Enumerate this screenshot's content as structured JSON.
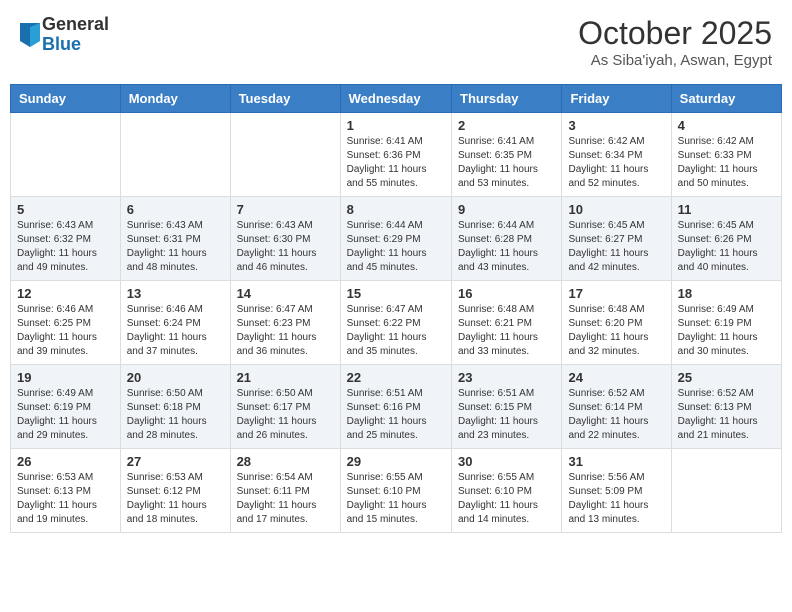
{
  "header": {
    "logo_general": "General",
    "logo_blue": "Blue",
    "month_title": "October 2025",
    "location": "As Siba'iyah, Aswan, Egypt"
  },
  "days_of_week": [
    "Sunday",
    "Monday",
    "Tuesday",
    "Wednesday",
    "Thursday",
    "Friday",
    "Saturday"
  ],
  "weeks": [
    [
      {
        "day": "",
        "info": ""
      },
      {
        "day": "",
        "info": ""
      },
      {
        "day": "",
        "info": ""
      },
      {
        "day": "1",
        "info": "Sunrise: 6:41 AM\nSunset: 6:36 PM\nDaylight: 11 hours and 55 minutes."
      },
      {
        "day": "2",
        "info": "Sunrise: 6:41 AM\nSunset: 6:35 PM\nDaylight: 11 hours and 53 minutes."
      },
      {
        "day": "3",
        "info": "Sunrise: 6:42 AM\nSunset: 6:34 PM\nDaylight: 11 hours and 52 minutes."
      },
      {
        "day": "4",
        "info": "Sunrise: 6:42 AM\nSunset: 6:33 PM\nDaylight: 11 hours and 50 minutes."
      }
    ],
    [
      {
        "day": "5",
        "info": "Sunrise: 6:43 AM\nSunset: 6:32 PM\nDaylight: 11 hours and 49 minutes."
      },
      {
        "day": "6",
        "info": "Sunrise: 6:43 AM\nSunset: 6:31 PM\nDaylight: 11 hours and 48 minutes."
      },
      {
        "day": "7",
        "info": "Sunrise: 6:43 AM\nSunset: 6:30 PM\nDaylight: 11 hours and 46 minutes."
      },
      {
        "day": "8",
        "info": "Sunrise: 6:44 AM\nSunset: 6:29 PM\nDaylight: 11 hours and 45 minutes."
      },
      {
        "day": "9",
        "info": "Sunrise: 6:44 AM\nSunset: 6:28 PM\nDaylight: 11 hours and 43 minutes."
      },
      {
        "day": "10",
        "info": "Sunrise: 6:45 AM\nSunset: 6:27 PM\nDaylight: 11 hours and 42 minutes."
      },
      {
        "day": "11",
        "info": "Sunrise: 6:45 AM\nSunset: 6:26 PM\nDaylight: 11 hours and 40 minutes."
      }
    ],
    [
      {
        "day": "12",
        "info": "Sunrise: 6:46 AM\nSunset: 6:25 PM\nDaylight: 11 hours and 39 minutes."
      },
      {
        "day": "13",
        "info": "Sunrise: 6:46 AM\nSunset: 6:24 PM\nDaylight: 11 hours and 37 minutes."
      },
      {
        "day": "14",
        "info": "Sunrise: 6:47 AM\nSunset: 6:23 PM\nDaylight: 11 hours and 36 minutes."
      },
      {
        "day": "15",
        "info": "Sunrise: 6:47 AM\nSunset: 6:22 PM\nDaylight: 11 hours and 35 minutes."
      },
      {
        "day": "16",
        "info": "Sunrise: 6:48 AM\nSunset: 6:21 PM\nDaylight: 11 hours and 33 minutes."
      },
      {
        "day": "17",
        "info": "Sunrise: 6:48 AM\nSunset: 6:20 PM\nDaylight: 11 hours and 32 minutes."
      },
      {
        "day": "18",
        "info": "Sunrise: 6:49 AM\nSunset: 6:19 PM\nDaylight: 11 hours and 30 minutes."
      }
    ],
    [
      {
        "day": "19",
        "info": "Sunrise: 6:49 AM\nSunset: 6:19 PM\nDaylight: 11 hours and 29 minutes."
      },
      {
        "day": "20",
        "info": "Sunrise: 6:50 AM\nSunset: 6:18 PM\nDaylight: 11 hours and 28 minutes."
      },
      {
        "day": "21",
        "info": "Sunrise: 6:50 AM\nSunset: 6:17 PM\nDaylight: 11 hours and 26 minutes."
      },
      {
        "day": "22",
        "info": "Sunrise: 6:51 AM\nSunset: 6:16 PM\nDaylight: 11 hours and 25 minutes."
      },
      {
        "day": "23",
        "info": "Sunrise: 6:51 AM\nSunset: 6:15 PM\nDaylight: 11 hours and 23 minutes."
      },
      {
        "day": "24",
        "info": "Sunrise: 6:52 AM\nSunset: 6:14 PM\nDaylight: 11 hours and 22 minutes."
      },
      {
        "day": "25",
        "info": "Sunrise: 6:52 AM\nSunset: 6:13 PM\nDaylight: 11 hours and 21 minutes."
      }
    ],
    [
      {
        "day": "26",
        "info": "Sunrise: 6:53 AM\nSunset: 6:13 PM\nDaylight: 11 hours and 19 minutes."
      },
      {
        "day": "27",
        "info": "Sunrise: 6:53 AM\nSunset: 6:12 PM\nDaylight: 11 hours and 18 minutes."
      },
      {
        "day": "28",
        "info": "Sunrise: 6:54 AM\nSunset: 6:11 PM\nDaylight: 11 hours and 17 minutes."
      },
      {
        "day": "29",
        "info": "Sunrise: 6:55 AM\nSunset: 6:10 PM\nDaylight: 11 hours and 15 minutes."
      },
      {
        "day": "30",
        "info": "Sunrise: 6:55 AM\nSunset: 6:10 PM\nDaylight: 11 hours and 14 minutes."
      },
      {
        "day": "31",
        "info": "Sunrise: 5:56 AM\nSunset: 5:09 PM\nDaylight: 11 hours and 13 minutes."
      },
      {
        "day": "",
        "info": ""
      }
    ]
  ]
}
